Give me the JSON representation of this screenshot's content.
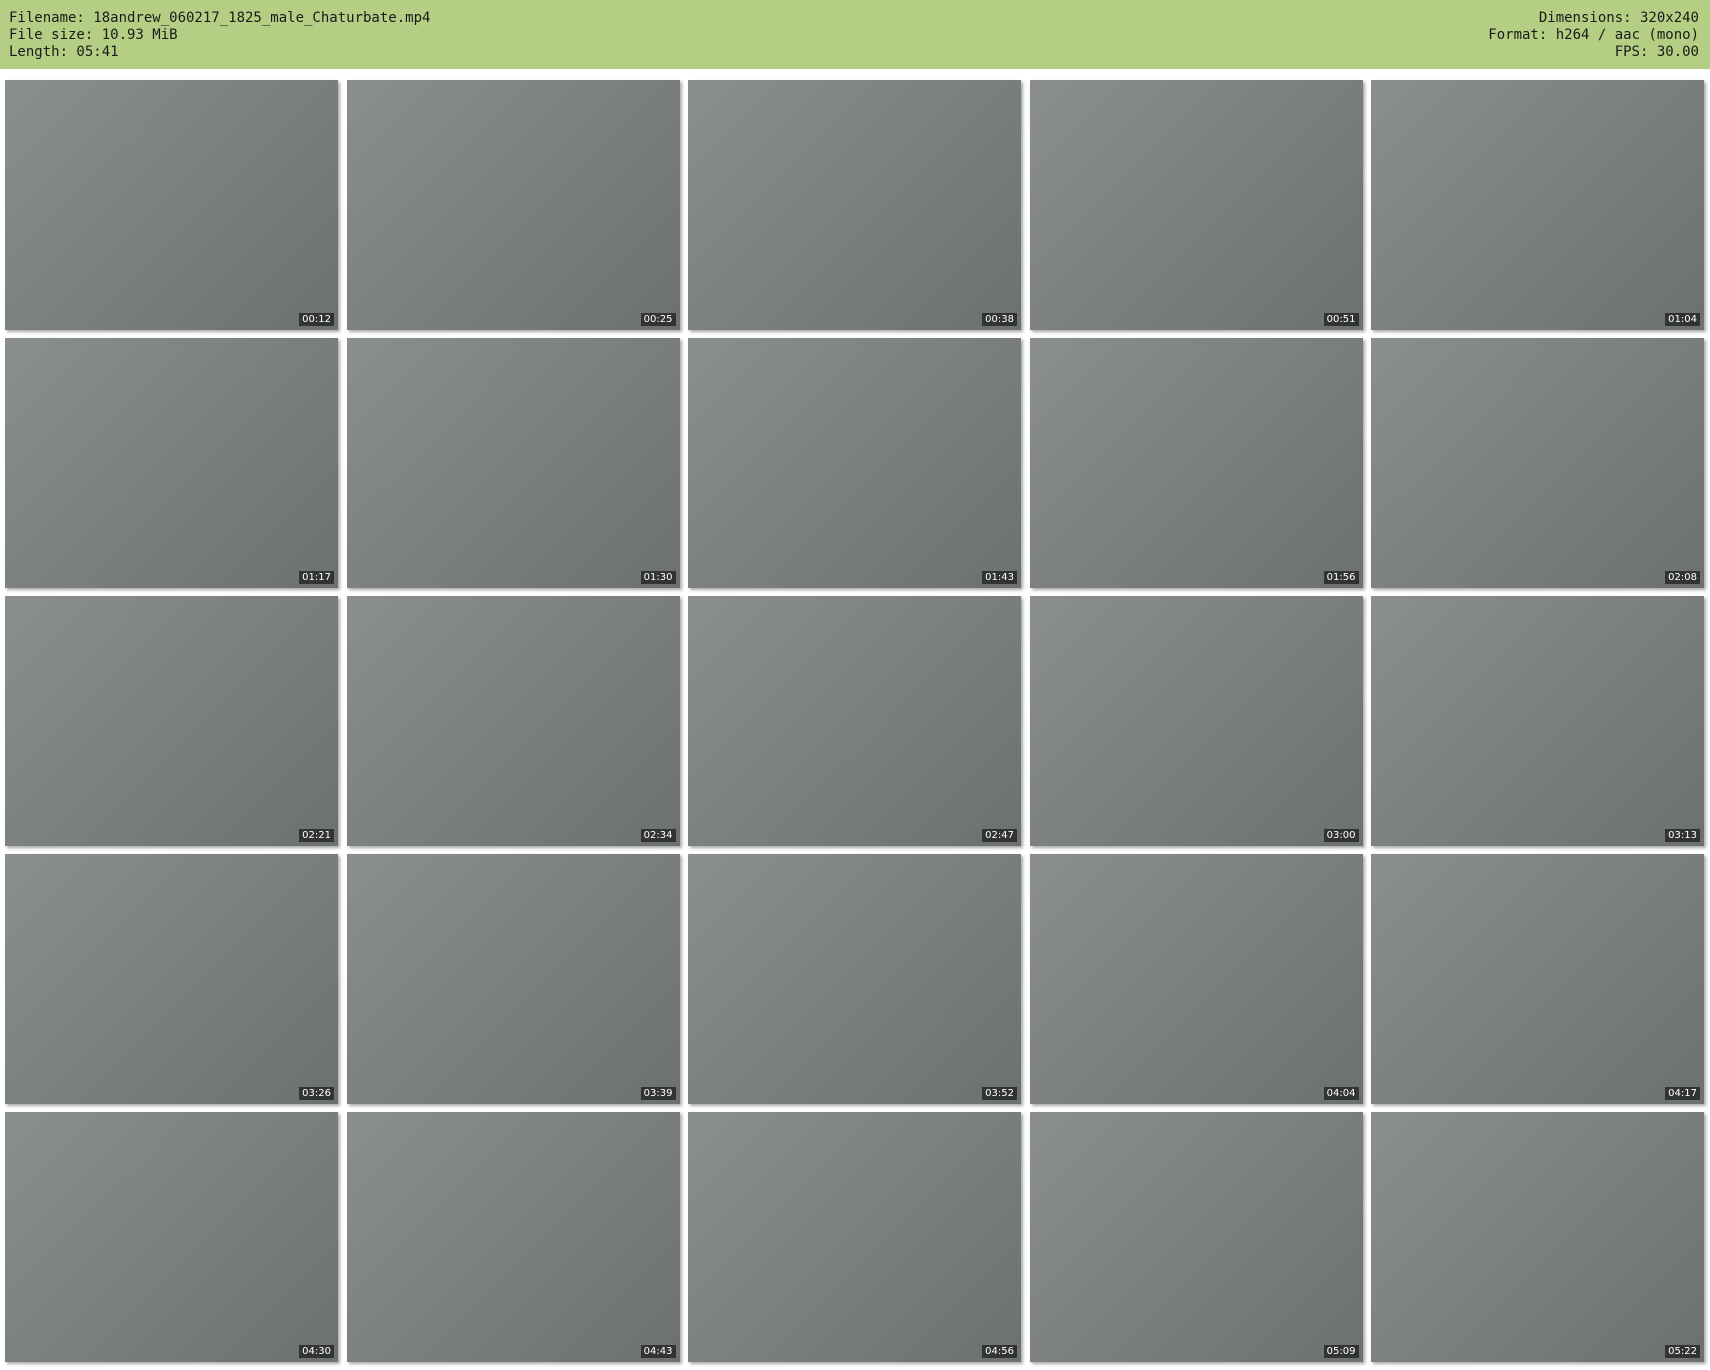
{
  "header": {
    "filename": "Filename: 18andrew_060217_1825_male_Chaturbate.mp4",
    "file_size": "File size: 10.93 MiB",
    "length": "Length: 05:41",
    "dimensions": "Dimensions: 320x240",
    "format": "Format: h264 / aac (mono)",
    "fps": "FPS: 30.00",
    "bg_color": "#b4cf84"
  },
  "thumbnails": [
    "00:12",
    "00:25",
    "00:38",
    "00:51",
    "01:04",
    "01:17",
    "01:30",
    "01:43",
    "01:56",
    "02:08",
    "02:21",
    "02:34",
    "02:47",
    "03:00",
    "03:13",
    "03:26",
    "03:39",
    "03:52",
    "04:04",
    "04:17",
    "04:30",
    "04:43",
    "04:56",
    "05:09",
    "05:22"
  ]
}
